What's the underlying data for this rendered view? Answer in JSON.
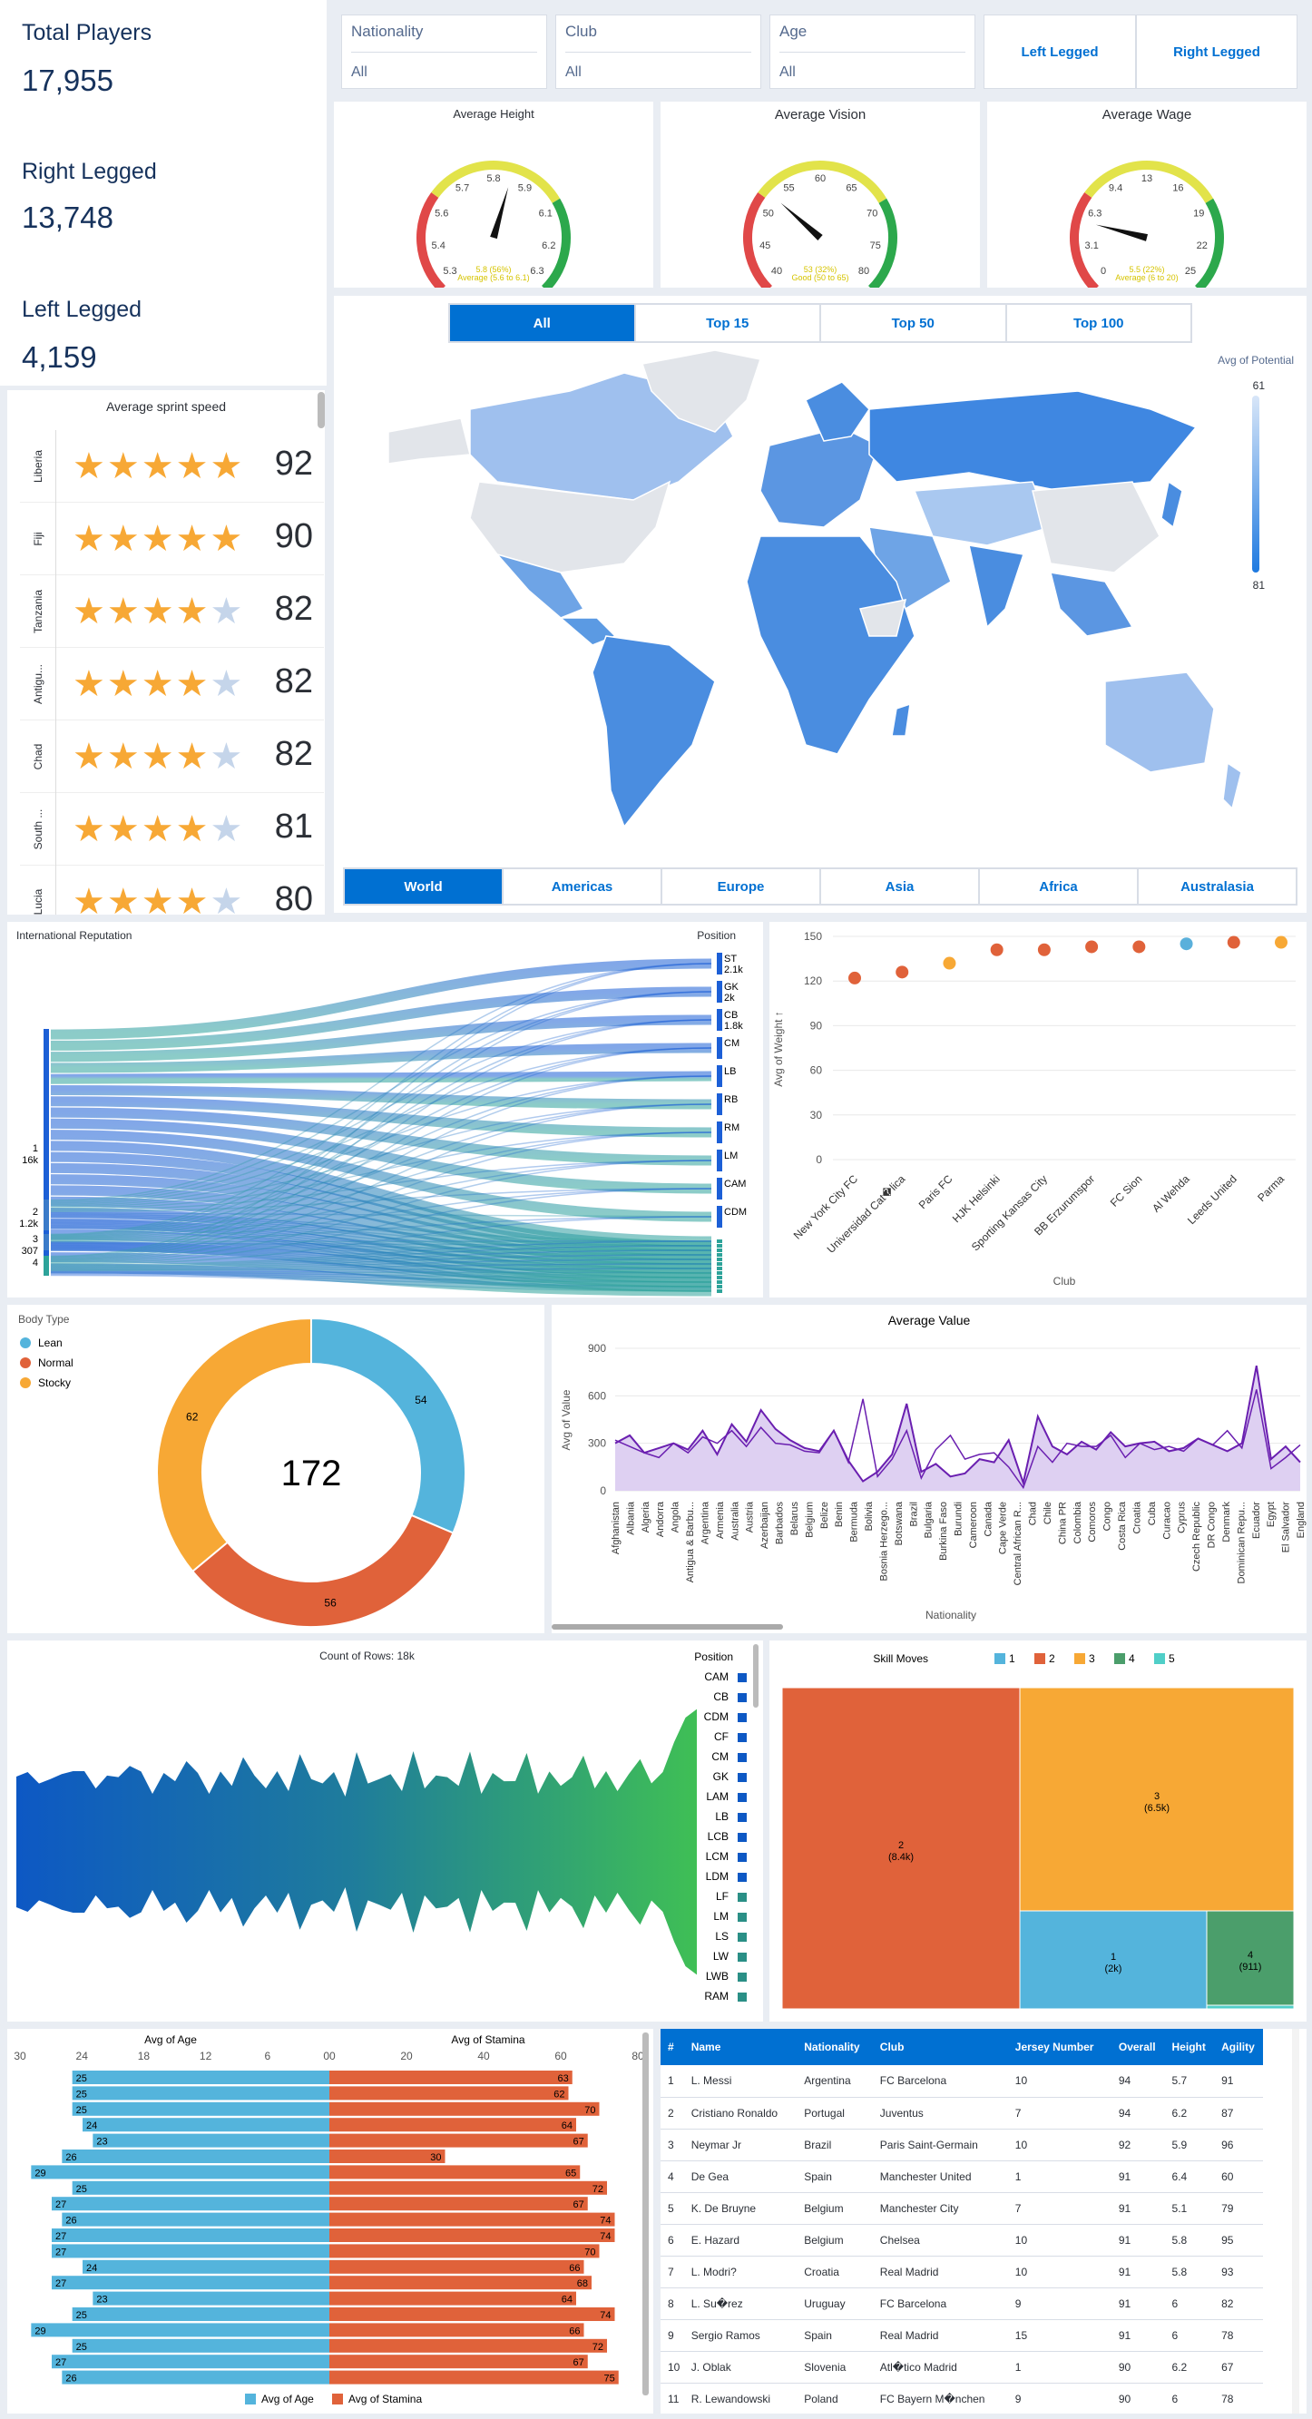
{
  "kpis": [
    {
      "title": "Total Players",
      "value": "17,955"
    },
    {
      "title": "Right Legged",
      "value": "13,748"
    },
    {
      "title": "Left Legged",
      "value": "4,159"
    }
  ],
  "filters": [
    {
      "label": "Nationality",
      "value": "All"
    },
    {
      "label": "Club",
      "value": "All"
    },
    {
      "label": "Age",
      "value": "All"
    }
  ],
  "foot_buttons": [
    "Left Legged",
    "Right Legged"
  ],
  "gauges": [
    {
      "title": "Average Height",
      "ticks": [
        "5.3",
        "5.4",
        "5.6",
        "5.7",
        "5.8",
        "5.9",
        "6.1",
        "6.2",
        "6.3"
      ],
      "value_label": "5.8 (56%)",
      "band_label": "Average (5.6 to 6.1)",
      "needle": 0.56
    },
    {
      "title": "Average Vision",
      "ticks": [
        "40",
        "45",
        "50",
        "55",
        "60",
        "65",
        "70",
        "75",
        "80"
      ],
      "value_label": "53 (32%)",
      "band_label": "Good (50 to 65)",
      "needle": 0.32
    },
    {
      "title": "Average Wage",
      "ticks": [
        "0",
        "3.1",
        "6.3",
        "9.4",
        "13",
        "16",
        "19",
        "22",
        "25"
      ],
      "value_label": "5.5 (22%)",
      "band_label": "Average (6 to 20)",
      "needle": 0.22
    }
  ],
  "map_tabs": [
    "All",
    "Top 15",
    "Top 50",
    "Top 100"
  ],
  "map_legend": {
    "title": "Avg of Potential",
    "max": "61",
    "min": "81"
  },
  "region_tabs": [
    "World",
    "Americas",
    "Europe",
    "Asia",
    "Africa",
    "Australasia"
  ],
  "sprint": {
    "title": "Average sprint speed",
    "rows": [
      {
        "country": "Liberia",
        "stars": 4.5,
        "value": "92"
      },
      {
        "country": "Fiji",
        "stars": 4.5,
        "value": "90"
      },
      {
        "country": "Tanzania",
        "stars": 4,
        "value": "82"
      },
      {
        "country": "Antigu...",
        "stars": 4,
        "value": "82"
      },
      {
        "country": "Chad",
        "stars": 4,
        "value": "82"
      },
      {
        "country": "South ...",
        "stars": 4,
        "value": "81"
      },
      {
        "country": "Lucia",
        "stars": 4,
        "value": "80"
      }
    ]
  },
  "sankey": {
    "left_title": "International Reputation",
    "right_title": "Position",
    "left": [
      {
        "label": "1",
        "sub": "16k"
      },
      {
        "label": "2",
        "sub": "1.2k"
      },
      {
        "label": "3",
        "sub": "307"
      },
      {
        "label": "4",
        "sub": ""
      }
    ],
    "right": [
      {
        "label": "ST",
        "sub": "2.1k"
      },
      {
        "label": "GK",
        "sub": "2k"
      },
      {
        "label": "CB",
        "sub": "1.8k"
      },
      {
        "label": "CM",
        "sub": ""
      },
      {
        "label": "LB",
        "sub": ""
      },
      {
        "label": "RB",
        "sub": ""
      },
      {
        "label": "RM",
        "sub": ""
      },
      {
        "label": "LM",
        "sub": ""
      },
      {
        "label": "CAM",
        "sub": ""
      },
      {
        "label": "CDM",
        "sub": ""
      }
    ]
  },
  "dot_chart": {
    "ylabel": "Avg of Weight ↑",
    "xlabel": "Club",
    "yticks": [
      "150",
      "120",
      "90",
      "60",
      "30",
      "0"
    ],
    "points": [
      {
        "club": "New York City FC",
        "value": 122,
        "color": "#e0623a"
      },
      {
        "club": "Universidad Cat�lica",
        "value": 126,
        "color": "#e0623a"
      },
      {
        "club": "Paris FC",
        "value": 132,
        "color": "#f7a835"
      },
      {
        "club": "HJK Helsinki",
        "value": 141,
        "color": "#e0623a"
      },
      {
        "club": "Sporting Kansas City",
        "value": 141,
        "color": "#e0623a"
      },
      {
        "club": "BB Erzurumspor",
        "value": 143,
        "color": "#e0623a"
      },
      {
        "club": "FC Sion",
        "value": 143,
        "color": "#e0623a"
      },
      {
        "club": "Al Wehda",
        "value": 145,
        "color": "#5ab0db"
      },
      {
        "club": "Leeds United",
        "value": 146,
        "color": "#e0623a"
      },
      {
        "club": "Parma",
        "value": 146,
        "color": "#f7a835"
      }
    ]
  },
  "donut": {
    "legend_title": "Body Type",
    "center": "172",
    "slices": [
      {
        "name": "Lean",
        "value": 54,
        "color": "#54b4dc"
      },
      {
        "name": "Normal",
        "value": 56,
        "color": "#e0623a"
      },
      {
        "name": "Stocky",
        "value": 62,
        "color": "#f7a835"
      }
    ]
  },
  "area": {
    "title": "Average Value",
    "ylabel": "Avg of Value",
    "xlabel": "Nationality",
    "yticks": [
      "900",
      "600",
      "300",
      "0"
    ],
    "categories": [
      "Afghanistan",
      "Albania",
      "Algeria",
      "Andorra",
      "Angola",
      "Antigua & Barbu...",
      "Argentina",
      "Armenia",
      "Australia",
      "Austria",
      "Azerbaijan",
      "Barbados",
      "Belarus",
      "Belgium",
      "Belize",
      "Benin",
      "Bermuda",
      "Bolivia",
      "Bosnia Herzego...",
      "Botswana",
      "Brazil",
      "Bulgaria",
      "Burkina Faso",
      "Burundi",
      "Cameroon",
      "Canada",
      "Cape Verde",
      "Central African R...",
      "Chad",
      "Chile",
      "China PR",
      "Colombia",
      "Comoros",
      "Congo",
      "Costa Rica",
      "Croatia",
      "Cuba",
      "Curacao",
      "Cyprus",
      "Czech Republic",
      "DR Congo",
      "Denmark",
      "Dominican Repu...",
      "Ecuador",
      "Egypt",
      "El Salvador",
      "England"
    ],
    "values": [
      300,
      350,
      240,
      270,
      300,
      260,
      380,
      230,
      420,
      310,
      510,
      390,
      320,
      270,
      250,
      380,
      190,
      60,
      120,
      230,
      550,
      120,
      170,
      90,
      110,
      200,
      180,
      320,
      50,
      470,
      280,
      230,
      310,
      260,
      370,
      280,
      300,
      310,
      250,
      270,
      330,
      290,
      250,
      300,
      790,
      200,
      280,
      180
    ],
    "values2": [
      320,
      280,
      240,
      210,
      300,
      240,
      340,
      300,
      380,
      280,
      400,
      300,
      290,
      250,
      240,
      380,
      180,
      580,
      90,
      200,
      380,
      80,
      260,
      350,
      200,
      230,
      240,
      150,
      20,
      280,
      180,
      300,
      280,
      280,
      350,
      210,
      300,
      260,
      280,
      250,
      330,
      290,
      380,
      270,
      640,
      140,
      210,
      290
    ]
  },
  "stream": {
    "title": "Count of Rows: 18k",
    "legend_title": "Position",
    "positions": [
      "CAM",
      "CB",
      "CDM",
      "CF",
      "CM",
      "GK",
      "LAM",
      "LB",
      "LCB",
      "LCM",
      "LDM",
      "LF",
      "LM",
      "LS",
      "LW",
      "LWB",
      "RAM"
    ]
  },
  "treemap": {
    "title": "Skill Moves",
    "legend": [
      "1",
      "2",
      "3",
      "4",
      "5"
    ],
    "colors": [
      "#54b4dc",
      "#e0623a",
      "#f7a835",
      "#4b9e6b",
      "#50cfc8"
    ],
    "cells": [
      {
        "label": "2",
        "sub": "(8.4k)"
      },
      {
        "label": "3",
        "sub": "(6.5k)"
      },
      {
        "label": "1",
        "sub": "(2k)"
      },
      {
        "label": "4",
        "sub": "(911)"
      }
    ]
  },
  "butterfly": {
    "left_title": "Avg of Age",
    "right_title": "Avg of Stamina",
    "left_ticks": [
      "30",
      "24",
      "18",
      "12",
      "6",
      "00"
    ],
    "right_ticks": [
      "20",
      "40",
      "60",
      "80"
    ],
    "age": [
      25,
      25,
      25,
      24,
      23,
      26,
      29,
      25,
      27,
      26,
      27,
      27,
      24,
      27,
      23,
      25,
      29,
      25,
      27,
      26
    ],
    "stamina": [
      63,
      62,
      70,
      64,
      67,
      30,
      65,
      72,
      67,
      74,
      74,
      70,
      66,
      68,
      64,
      74,
      66,
      72,
      67,
      75
    ],
    "legend": [
      "Avg of Age",
      "Avg of Stamina"
    ]
  },
  "table": {
    "headers": [
      "#",
      "Name",
      "Nationality",
      "Club",
      "Jersey Number",
      "Overall",
      "Height",
      "Agility"
    ],
    "rows": [
      [
        "1",
        "L. Messi",
        "Argentina",
        "FC Barcelona",
        "10",
        "94",
        "5.7",
        "91"
      ],
      [
        "2",
        "Cristiano Ronaldo",
        "Portugal",
        "Juventus",
        "7",
        "94",
        "6.2",
        "87"
      ],
      [
        "3",
        "Neymar Jr",
        "Brazil",
        "Paris Saint-Germain",
        "10",
        "92",
        "5.9",
        "96"
      ],
      [
        "4",
        "De Gea",
        "Spain",
        "Manchester United",
        "1",
        "91",
        "6.4",
        "60"
      ],
      [
        "5",
        "K. De Bruyne",
        "Belgium",
        "Manchester City",
        "7",
        "91",
        "5.1",
        "79"
      ],
      [
        "6",
        "E. Hazard",
        "Belgium",
        "Chelsea",
        "10",
        "91",
        "5.8",
        "95"
      ],
      [
        "7",
        "L. Modri?",
        "Croatia",
        "Real Madrid",
        "10",
        "91",
        "5.8",
        "93"
      ],
      [
        "8",
        "L. Su�rez",
        "Uruguay",
        "FC Barcelona",
        "9",
        "91",
        "6",
        "82"
      ],
      [
        "9",
        "Sergio Ramos",
        "Spain",
        "Real Madrid",
        "15",
        "91",
        "6",
        "78"
      ],
      [
        "10",
        "J. Oblak",
        "Slovenia",
        "Atl�tico Madrid",
        "1",
        "90",
        "6.2",
        "67"
      ],
      [
        "11",
        "R. Lewandowski",
        "Poland",
        "FC Bayern M�nchen",
        "9",
        "90",
        "6",
        "78"
      ]
    ]
  }
}
